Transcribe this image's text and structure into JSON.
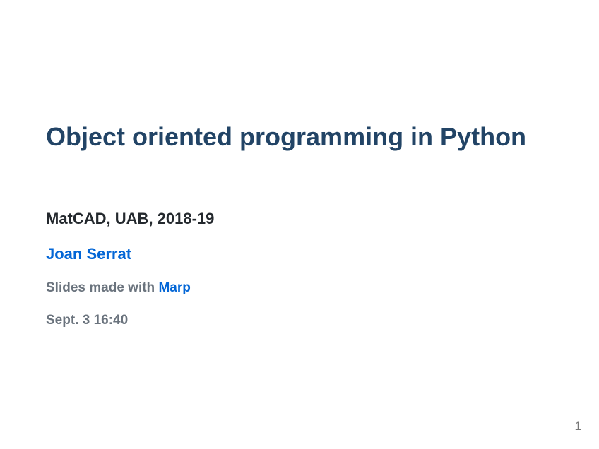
{
  "slide": {
    "title": "Object oriented programming in Python",
    "course": "MatCAD, UAB, 2018-19",
    "author": "Joan Serrat",
    "credit_prefix": "Slides made with ",
    "credit_link": "Marp",
    "date": "Sept. 3 16:40",
    "page_number": "1"
  },
  "colors": {
    "title": "#224466",
    "text": "#24292e",
    "link": "#0366d6",
    "muted": "#6a737d"
  }
}
